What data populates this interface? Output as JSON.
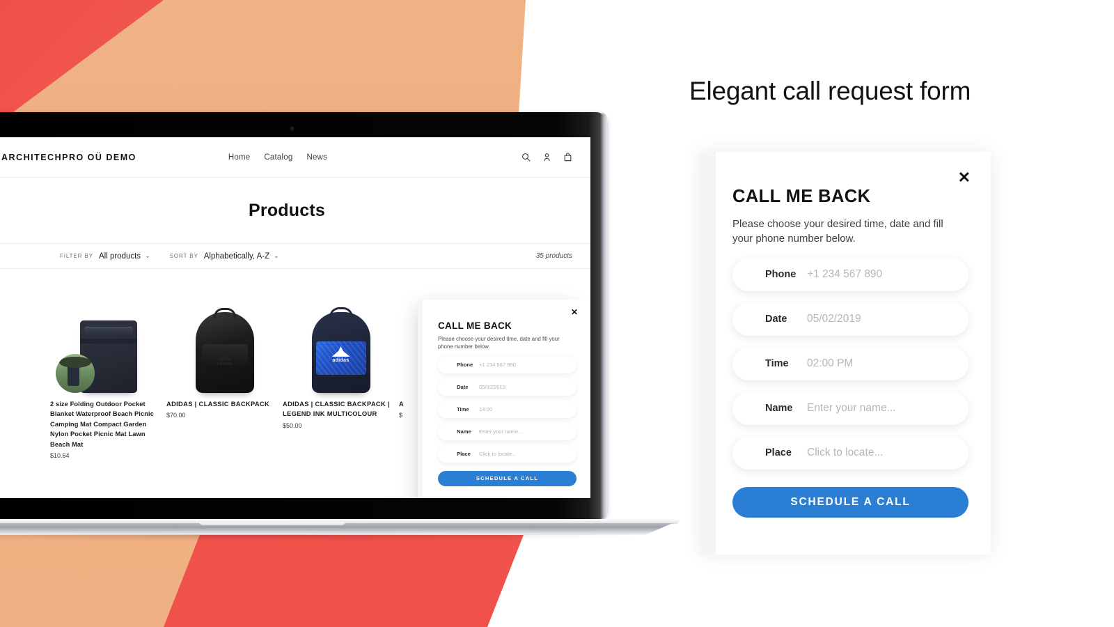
{
  "headline": "Elegant call request form",
  "colors": {
    "accent_blue": "#2a7fd4",
    "bg_red": "#f0514b",
    "bg_peach": "#eeab7c",
    "text_dark": "#111111",
    "placeholder_gray": "#b6b6b6"
  },
  "shop": {
    "logo": "ARCHITECHPRO OÜ DEMO",
    "nav": [
      {
        "label": "Home"
      },
      {
        "label": "Catalog"
      },
      {
        "label": "News"
      }
    ],
    "icons": [
      {
        "name": "search-icon"
      },
      {
        "name": "account-icon"
      },
      {
        "name": "cart-icon"
      }
    ],
    "page_title": "Products",
    "filters": {
      "filter_label": "FILTER BY",
      "filter_value": "All products",
      "sort_label": "SORT BY",
      "sort_value": "Alphabetically, A-Z",
      "chevron": "⌄",
      "count": "35 products"
    },
    "products": [
      {
        "name": "2 size Folding Outdoor Pocket Blanket Waterproof Beach Picnic Camping Mat Compact Garden Nylon Pocket Picnic Mat Lawn Beach Mat",
        "price": "$10.64"
      },
      {
        "name": "ADIDAS | CLASSIC BACKPACK",
        "price": "$70.00"
      },
      {
        "name": "ADIDAS | CLASSIC BACKPACK | LEGEND INK MULTICOLOUR",
        "price": "$50.00"
      },
      {
        "name": "A",
        "price": "$"
      }
    ]
  },
  "modal": {
    "close": "✕",
    "title": "CALL ME BACK",
    "subtitle": "Please choose your desired time, date and fill your phone number below.",
    "fields_big": [
      {
        "label": "Phone",
        "value": "+1 234 567 890"
      },
      {
        "label": "Date",
        "value": "05/02/2019"
      },
      {
        "label": "Time",
        "value": "02:00 PM"
      },
      {
        "label": "Name",
        "value": "Enter your name..."
      },
      {
        "label": "Place",
        "value": "Click to locate..."
      }
    ],
    "fields_small": [
      {
        "label": "Phone",
        "value": "+1 234 567 890"
      },
      {
        "label": "Date",
        "value": "05/02/2019"
      },
      {
        "label": "Time",
        "value": "14:00"
      },
      {
        "label": "Name",
        "value": "Enter your name..."
      },
      {
        "label": "Place",
        "value": "Click to locate..."
      }
    ],
    "submit_label": "SCHEDULE A CALL"
  }
}
